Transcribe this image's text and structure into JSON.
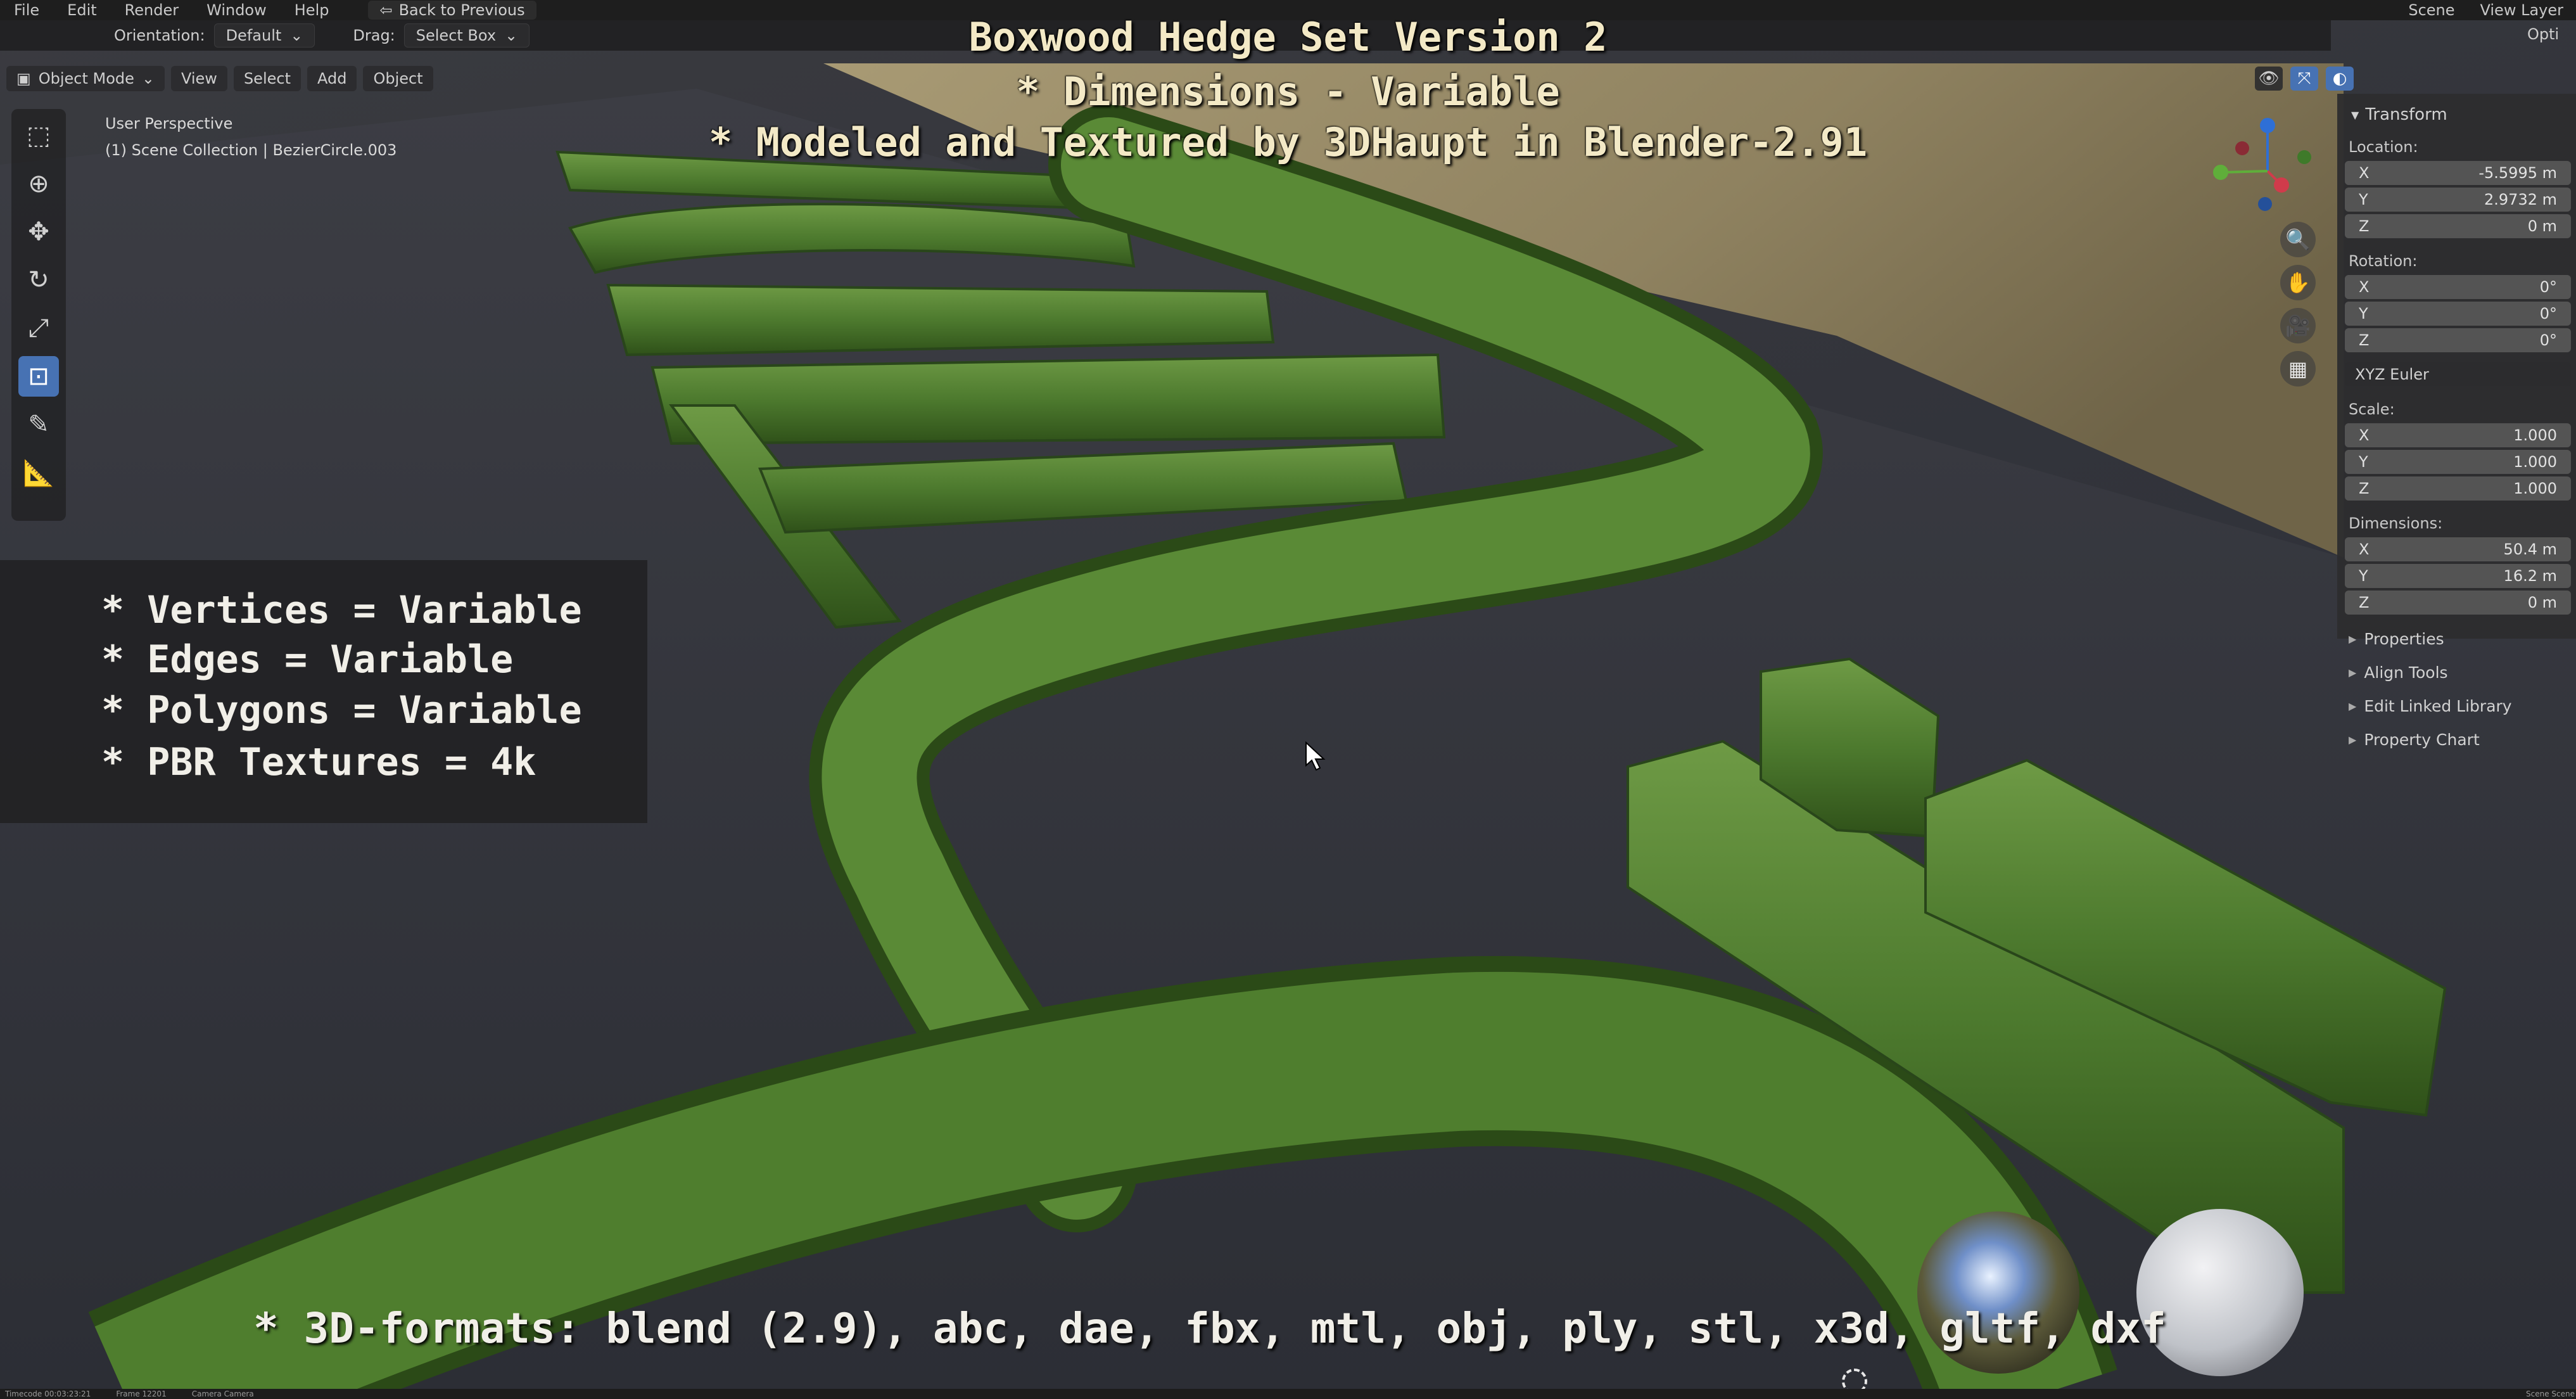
{
  "app": {
    "menu": [
      "File",
      "Edit",
      "Render",
      "Window",
      "Help"
    ],
    "back_button": "Back to Previous",
    "scene_label": "Scene",
    "view_layer_label": "View Layer",
    "options_label": "Opti"
  },
  "header": {
    "orientation_label": "Orientation:",
    "orientation_value": "Default",
    "drag_label": "Drag:",
    "drag_value": "Select Box"
  },
  "modebar": {
    "mode": "Object Mode",
    "menus": [
      "View",
      "Select",
      "Add",
      "Object"
    ]
  },
  "viewport_info": {
    "perspective": "User Perspective",
    "collection": "(1) Scene Collection | BezierCircle.003"
  },
  "overlay": {
    "title": "Boxwood Hedge Set Version 2",
    "line2": "* Dimensions - Variable",
    "line3": "* Modeled and Textured by 3DHaupt in Blender-2.91",
    "stats": [
      "* Vertices = Variable",
      "* Edges = Variable",
      "* Polygons = Variable",
      "* PBR Textures = 4k"
    ],
    "formats": "* 3D-formats: blend (2.9), abc, dae, fbx, mtl, obj, ply, stl, x3d, gltf, dxf"
  },
  "npanel": {
    "section": "Transform",
    "location_label": "Location:",
    "location": {
      "x": "-5.5995 m",
      "y": "2.9732 m",
      "z": "0 m"
    },
    "rotation_label": "Rotation:",
    "rotation": {
      "x": "0°",
      "y": "0°",
      "z": "0°"
    },
    "rotation_mode": "XYZ Euler",
    "scale_label": "Scale:",
    "scale": {
      "x": "1.000",
      "y": "1.000",
      "z": "1.000"
    },
    "dimensions_label": "Dimensions:",
    "dimensions": {
      "x": "50.4 m",
      "y": "16.2 m",
      "z": "0 m"
    },
    "axis_labels": {
      "x": "X",
      "y": "Y",
      "z": "Z"
    },
    "subpanels": [
      "Properties",
      "Align Tools",
      "Edit Linked Library",
      "Property Chart"
    ]
  },
  "statusbar": {
    "left": "Timecode 00:03:23:21",
    "frame": "Frame 12201",
    "camera": "Camera Camera",
    "right": "Scene Scene"
  },
  "icons": {
    "select": "select-box-icon",
    "cursor": "cursor-icon",
    "move": "move-icon",
    "rotate": "rotate-icon",
    "scale": "scale-icon",
    "transform": "transform-icon",
    "annotate": "annotate-icon",
    "measure": "measure-icon"
  }
}
